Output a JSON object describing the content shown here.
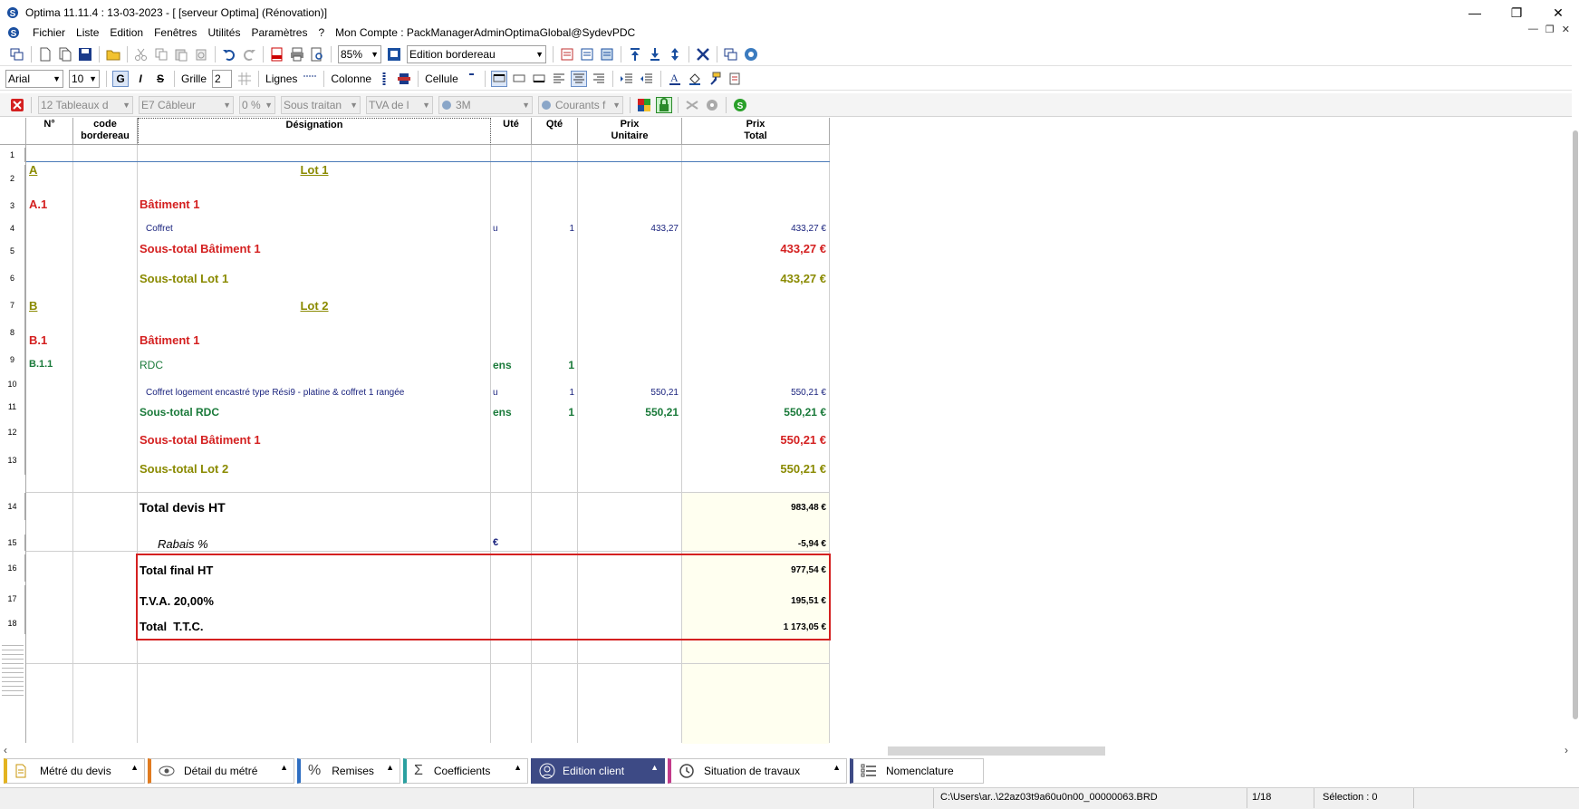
{
  "window": {
    "title": "Optima 11.11.4 : 13-03-2023 - [ [serveur Optima] (Rénovation)]"
  },
  "menu": {
    "items": [
      "Fichier",
      "Liste",
      "Edition",
      "Fenêtres",
      "Utilités",
      "Paramètres",
      "?"
    ],
    "account": "Mon Compte : PackManagerAdminOptimaGlobal@SydevPDC"
  },
  "toolbar1": {
    "zoom": "85%",
    "view": "Edition bordereau"
  },
  "toolbar2": {
    "font": "Arial",
    "size": "10",
    "bold": "G",
    "italic": "I",
    "strike": "S",
    "grille_label": "Grille",
    "grille_value": "2",
    "lignes_label": "Lignes",
    "colonne_label": "Colonne",
    "cellule_label": "Cellule"
  },
  "toolbar3": {
    "c1": "12  Tableaux d",
    "c2": "E7  Câbleur",
    "c3": "0 %",
    "c4": "Sous traitan",
    "c5": "TVA de l",
    "c6": "3M",
    "c7": "Courants f"
  },
  "grid": {
    "headers": {
      "num": "N°",
      "code_l1": "code",
      "code_l2": "bordereau",
      "designation": "Désignation",
      "ute": "Uté",
      "qte": "Qté",
      "pu_l1": "Prix",
      "pu_l2": "Unitaire",
      "pt_l1": "Prix",
      "pt_l2": "Total"
    },
    "row_numbers": [
      "1",
      "2",
      "3",
      "4",
      "5",
      "6",
      "7",
      "8",
      "9",
      "10",
      "11",
      "12",
      "13",
      "14",
      "15",
      "16",
      "17",
      "18"
    ],
    "rows": {
      "r2": {
        "num": "A",
        "designation": "Lot 1"
      },
      "r3": {
        "num": "A.1",
        "designation": "Bâtiment 1"
      },
      "r4": {
        "designation": "Coffret",
        "ute": "u",
        "qte": "1",
        "pu": "433,27",
        "pt": "433,27 €"
      },
      "r5": {
        "designation": "Sous-total Bâtiment 1",
        "pt": "433,27 €"
      },
      "r6": {
        "designation": "Sous-total Lot 1",
        "pt": "433,27 €"
      },
      "r7": {
        "num": "B",
        "designation": "Lot 2"
      },
      "r8": {
        "num": "B.1",
        "designation": "Bâtiment 1"
      },
      "r9": {
        "num": "B.1.1",
        "designation": "RDC",
        "ute": "ens",
        "qte": "1"
      },
      "r10": {
        "designation": "Coffret logement encastré type Rési9 - platine & coffret 1 rangée",
        "ute": "u",
        "qte": "1",
        "pu": "550,21",
        "pt": "550,21 €"
      },
      "r11": {
        "designation": "Sous-total RDC",
        "ute": "ens",
        "qte": "1",
        "pu": "550,21",
        "pt": "550,21 €"
      },
      "r12": {
        "designation": "Sous-total Bâtiment 1",
        "pt": "550,21 €"
      },
      "r13": {
        "designation": "Sous-total Lot 2",
        "pt": "550,21 €"
      },
      "r14": {
        "designation": "Total devis HT",
        "pt": "983,48 €"
      },
      "r15": {
        "designation": "Rabais %",
        "ute": "€",
        "pt": "-5,94 €"
      },
      "r16": {
        "designation": "Total final HT",
        "pt": "977,54 €"
      },
      "r17": {
        "designation": "T.V.A. 20,00%",
        "pt": "195,51 €"
      },
      "r18": {
        "designation": "Total  T.T.C.",
        "pt": "1 173,05 €"
      }
    }
  },
  "tabs": [
    {
      "label": "Métré du devis"
    },
    {
      "label": "Détail du métré"
    },
    {
      "label": "Remises"
    },
    {
      "label": "Coefficients"
    },
    {
      "label": "Edition client"
    },
    {
      "label": "Situation de travaux"
    },
    {
      "label": "Nomenclature"
    }
  ],
  "status": {
    "path": "C:\\Users\\ar..\\22az03t9a60u0n00_00000063.BRD",
    "page": "1/18",
    "selection": "Sélection : 0"
  },
  "colors": {
    "lot": "#8a8a00",
    "batiment": "#d42020",
    "rdc": "#1a7a3a",
    "item": "#1a237e",
    "highlight_box": "#d42020",
    "total_bg": "#fffff0",
    "active_tab": "#3d4a85"
  }
}
